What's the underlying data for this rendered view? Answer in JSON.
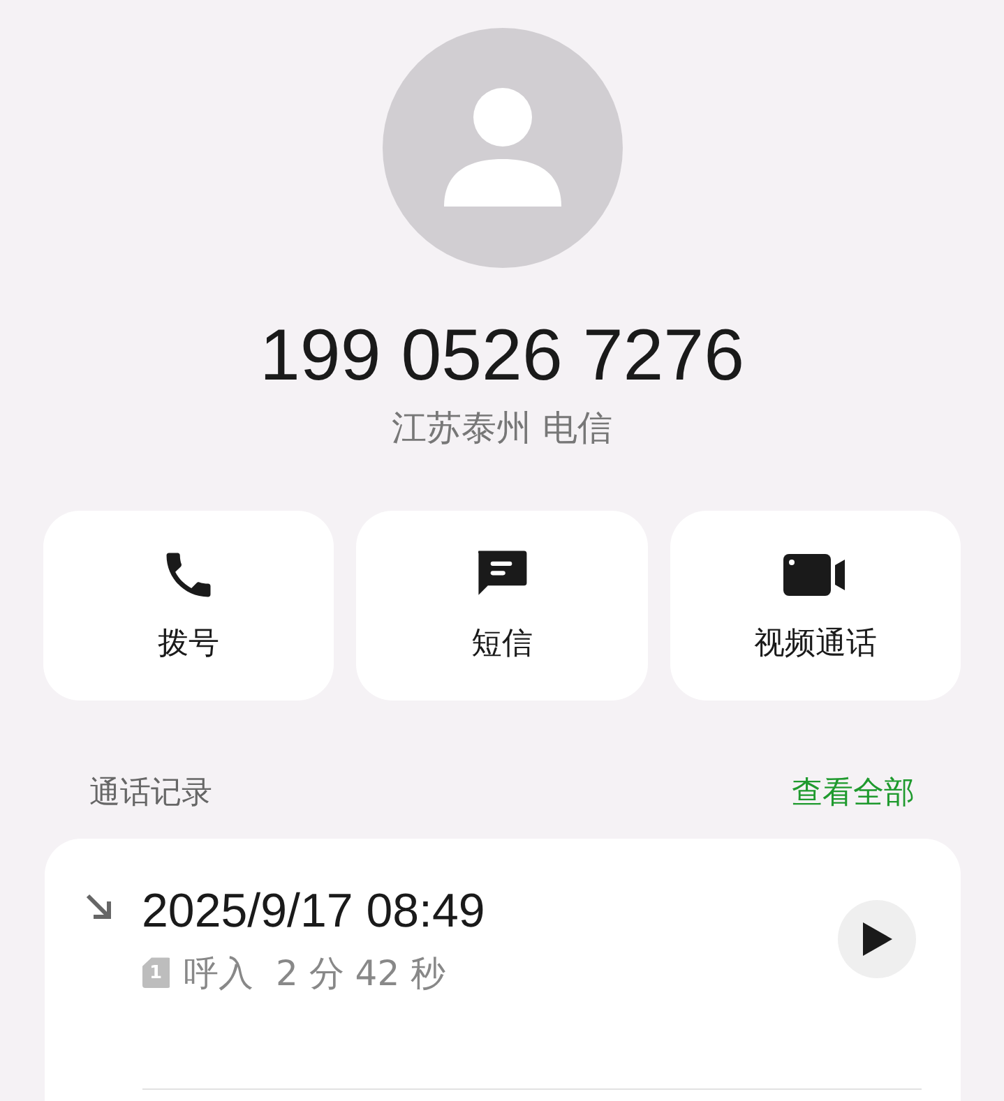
{
  "contact": {
    "number": "199 0526 7276",
    "location": "江苏泰州 电信"
  },
  "actions": [
    {
      "kind": "call",
      "label": "拨号"
    },
    {
      "kind": "message",
      "label": "短信"
    },
    {
      "kind": "video",
      "label": "视频通话"
    }
  ],
  "call_log": {
    "title": "通话记录",
    "view_all": "查看全部",
    "entries": [
      {
        "incoming": true,
        "datetime": "2025/9/17 08:49",
        "sim": "1",
        "type": "呼入",
        "duration": "2 分 42 秒"
      }
    ]
  }
}
